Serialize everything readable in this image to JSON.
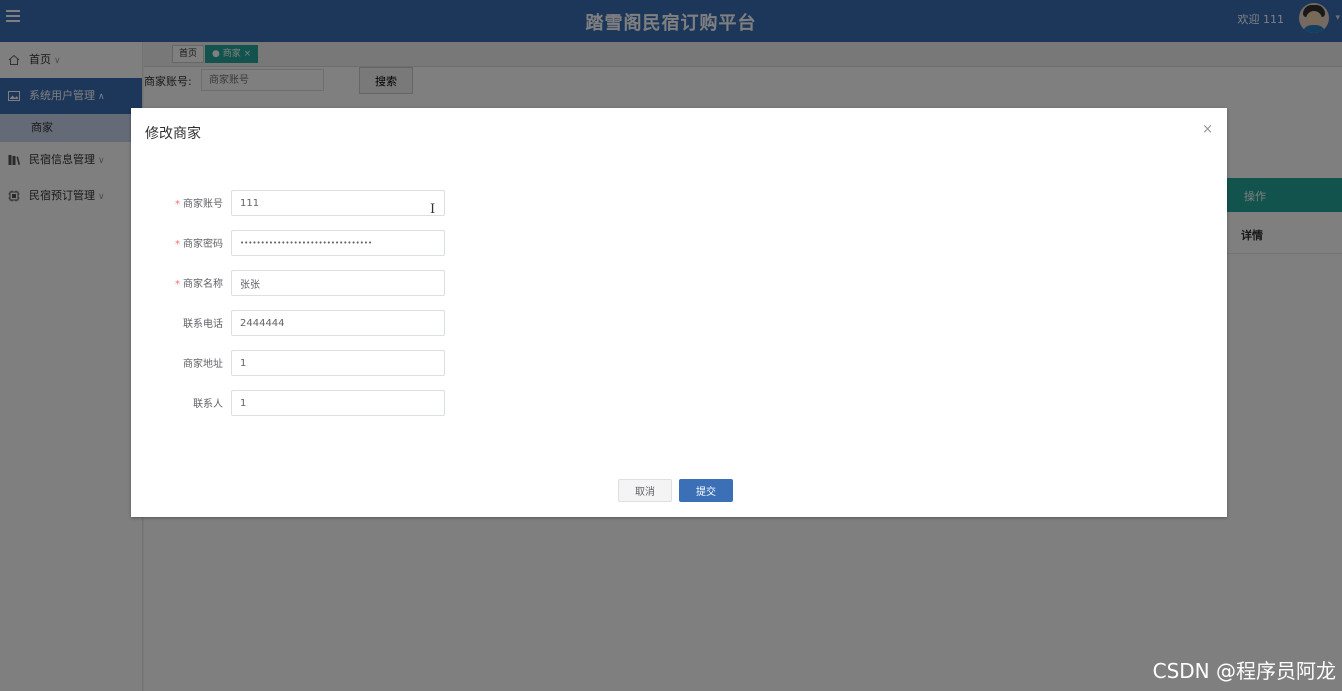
{
  "header": {
    "title": "踏雪阁民宿订购平台",
    "welcome": "欢迎 111"
  },
  "sidebar": {
    "items": [
      {
        "label": "首页"
      },
      {
        "label": "系统用户管理"
      },
      {
        "label": "民宿信息管理"
      },
      {
        "label": "民宿预订管理"
      }
    ],
    "sub_item": "商家"
  },
  "tabs": [
    {
      "label": "首页"
    },
    {
      "label": "● 商家 ×"
    }
  ],
  "search": {
    "label": "商家账号:",
    "placeholder": "商家账号",
    "button": "搜索"
  },
  "table": {
    "op_header": "操作",
    "row_action": "详情"
  },
  "dialog": {
    "title": "修改商家",
    "close": "×",
    "fields": [
      {
        "label": "商家账号",
        "required": "*",
        "value": "111"
      },
      {
        "label": "商家密码",
        "required": "*",
        "value": "••••••••••••••••••••••••••••••••"
      },
      {
        "label": "商家名称",
        "required": "*",
        "value": "张张"
      },
      {
        "label": "联系电话",
        "required": "",
        "value": "2444444"
      },
      {
        "label": "商家地址",
        "required": "",
        "value": "1"
      },
      {
        "label": "联系人",
        "required": "",
        "value": "1"
      }
    ],
    "cancel": "取消",
    "submit": "提交"
  },
  "watermark": "CSDN @程序员阿龙",
  "colors": {
    "primary": "#3b6fb6",
    "table_header": "#26a69a"
  }
}
